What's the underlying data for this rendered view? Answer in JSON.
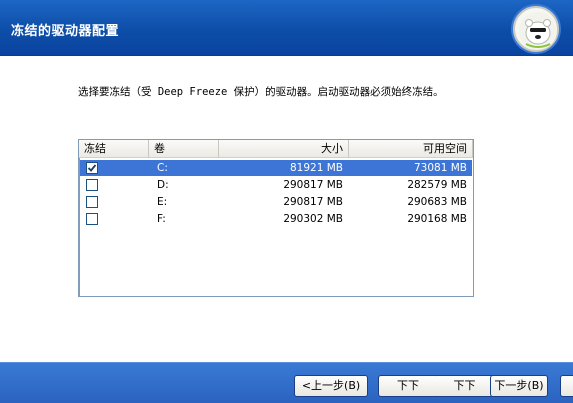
{
  "header": {
    "title": "冻结的驱动器配置",
    "logo": "polar-bear-logo"
  },
  "instruction": "选择要冻结（受 Deep Freeze 保护）的驱动器。启动驱动器必须始终冻结。",
  "drives_table": {
    "columns": [
      "冻结",
      "卷",
      "大小",
      "可用空间"
    ],
    "rows": [
      {
        "frozen": true,
        "drive": "C:",
        "size": "81921 MB",
        "free": "73081 MB",
        "selected": true
      },
      {
        "frozen": false,
        "drive": "D:",
        "size": "290817 MB",
        "free": "282579 MB",
        "selected": false
      },
      {
        "frozen": false,
        "drive": "E:",
        "size": "290817 MB",
        "free": "290683 MB",
        "selected": false
      },
      {
        "frozen": false,
        "drive": "F:",
        "size": "290302 MB",
        "free": "290168 MB",
        "selected": false
      }
    ]
  },
  "footer": {
    "back_label": "<上一步(B)",
    "next_label_a": "下下",
    "next_label_b": "下下",
    "next_label_c": "下一步(B)"
  },
  "colors": {
    "header": "#0d4ea8",
    "selection": "#3c75d6",
    "footer": "#2a63c0"
  }
}
